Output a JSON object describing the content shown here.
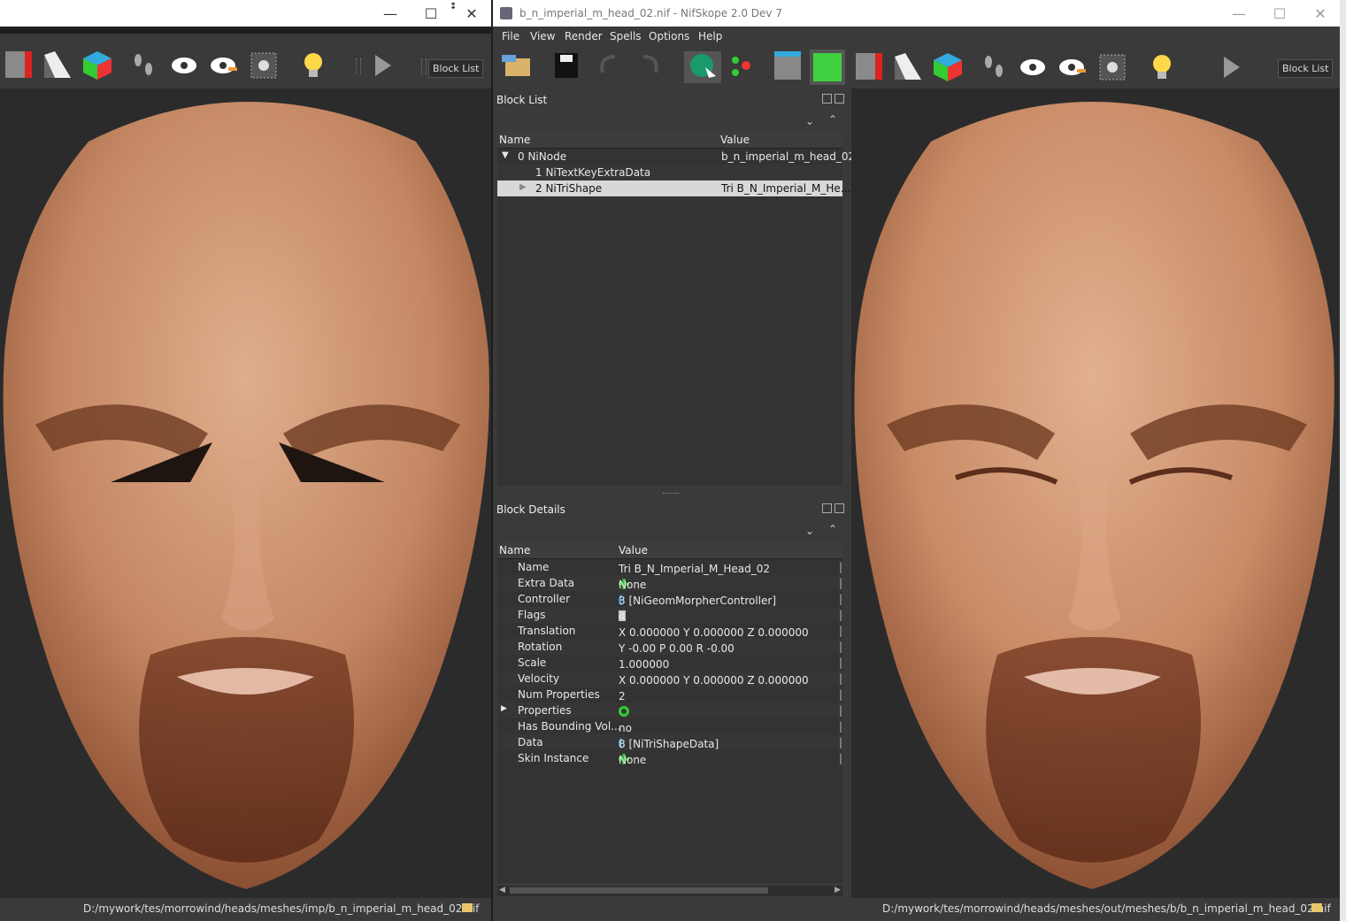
{
  "left_window": {
    "toolbar": {
      "block_list_label": "Block List"
    },
    "status_path": "D:/mywork/tes/morrowind/heads/meshes/imp/b_n_imperial_m_head_02.nif"
  },
  "main_window": {
    "title": "b_n_imperial_m_head_02.nif - NifSkope 2.0 Dev 7",
    "menu": [
      "File",
      "View",
      "Render",
      "Spells",
      "Options",
      "Help"
    ],
    "toolbar": {
      "block_list_label": "Block List"
    },
    "status_path": "D:/mywork/tes/morrowind/heads/meshes/out/meshes/b/b_n_imperial_m_head_02.nif"
  },
  "block_list": {
    "title": "Block List",
    "headers": {
      "name": "Name",
      "value": "Value"
    },
    "rows": [
      {
        "name": "0 NiNode",
        "value": "b_n_imperial_m_head_02"
      },
      {
        "name": "1 NiTextKeyExtraData",
        "value": ""
      },
      {
        "name": "2 NiTriShape",
        "value": "Tri B_N_Imperial_M_He..."
      }
    ]
  },
  "block_details": {
    "title": "Block Details",
    "headers": {
      "name": "Name",
      "value": "Value"
    },
    "rows": [
      {
        "name": "Name",
        "value": "Tri B_N_Imperial_M_Head_02",
        "icon": ""
      },
      {
        "name": "Extra Data",
        "value": "None",
        "icon": "green-plus"
      },
      {
        "name": "Controller",
        "value": "3 [NiGeomMorpherController]",
        "icon": "link"
      },
      {
        "name": "Flags",
        "value": "4",
        "icon": "flag"
      },
      {
        "name": "Translation",
        "value": "X 0.000000 Y 0.000000 Z 0.000000",
        "icon": ""
      },
      {
        "name": "Rotation",
        "value": "Y -0.00 P 0.00 R -0.00",
        "icon": ""
      },
      {
        "name": "Scale",
        "value": "1.000000",
        "icon": ""
      },
      {
        "name": "Velocity",
        "value": "X 0.000000 Y 0.000000 Z 0.000000",
        "icon": ""
      },
      {
        "name": "Num Properties",
        "value": "2",
        "icon": ""
      },
      {
        "name": "Properties",
        "value": "",
        "icon": "green-refresh"
      },
      {
        "name": "Has Bounding Vol...",
        "value": "no",
        "icon": ""
      },
      {
        "name": "Data",
        "value": "8 [NiTriShapeData]",
        "icon": "link"
      },
      {
        "name": "Skin Instance",
        "value": "None",
        "icon": "green-plus"
      }
    ]
  },
  "colors": {
    "skin": "#c98f6c",
    "beard": "#6b3520",
    "background": "#2b2b2b"
  }
}
